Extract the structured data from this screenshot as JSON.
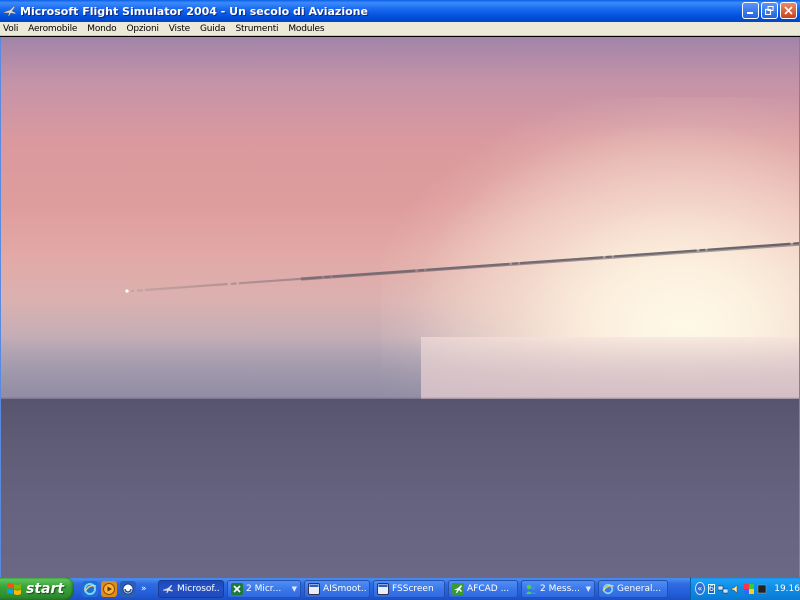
{
  "window": {
    "title": "Microsoft Flight Simulator 2004 - Un secolo di Aviazione",
    "controls": [
      "minimize",
      "restore",
      "close"
    ]
  },
  "menu": {
    "items": [
      "Voli",
      "Aeromobile",
      "Mondo",
      "Opzioni",
      "Viste",
      "Guida",
      "Strumenti",
      "Modules"
    ]
  },
  "viewport": {
    "scene": "sunset sky with contrail over flat terrain",
    "colors": {
      "sky_top": "#a184a8",
      "sky_mid": "#de9c9c",
      "sun_glow": "#fff8e6",
      "ground": "#5e5c77"
    }
  },
  "taskbar": {
    "start_label": "start",
    "quicklaunch_more": "»",
    "buttons": [
      {
        "label": "Microsof...",
        "icon": "flight-sim-icon",
        "active": true,
        "arrow": false
      },
      {
        "label": "2 Micr...",
        "icon": "excel-icon",
        "active": false,
        "arrow": true
      },
      {
        "label": "AISmoot...",
        "icon": "app-window-icon",
        "active": false,
        "arrow": false
      },
      {
        "label": "FSScreen",
        "icon": "app-window-icon",
        "active": false,
        "arrow": false
      },
      {
        "label": "AFCAD ...",
        "icon": "afcad-icon",
        "active": false,
        "arrow": false
      },
      {
        "label": "2 Mess...",
        "icon": "messenger-icon",
        "active": false,
        "arrow": true
      },
      {
        "label": "General...",
        "icon": "ie-icon",
        "active": false,
        "arrow": false
      }
    ],
    "tray": {
      "badge": "6",
      "clock": "19.16"
    }
  }
}
